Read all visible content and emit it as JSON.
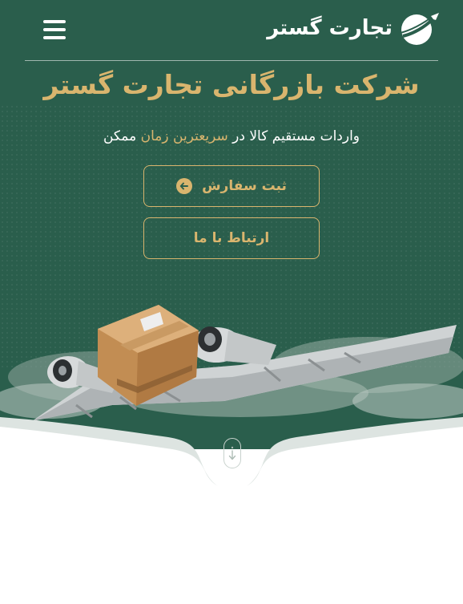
{
  "header": {
    "logo_text": "تجارت گستر",
    "logo_icon": "globe-plane-icon",
    "menu_icon": "hamburger-menu-icon"
  },
  "hero": {
    "title": "شرکت بازرگانی تجارت گستر",
    "subtitle_start": "واردات مستقیم کالا در ",
    "subtitle_accent": "سریعترین زمان",
    "subtitle_end": " ممکن",
    "order_button": "ثبت سفارش",
    "order_icon": "arrow-left-circle-icon",
    "contact_button": "ارتباط با ما",
    "scroll_icon": "scroll-down-arrow-icon"
  },
  "colors": {
    "background": "#2a5e4c",
    "accent": "#d9b56e",
    "text": "#ffffff"
  }
}
